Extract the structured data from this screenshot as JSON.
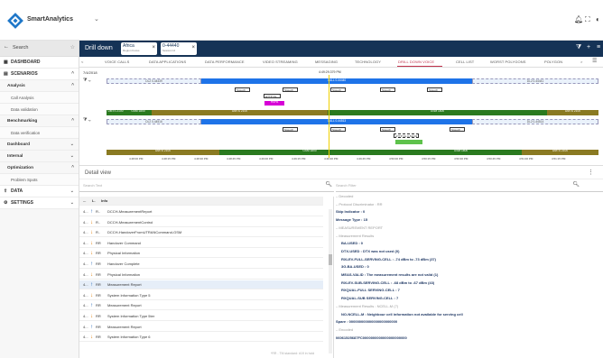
{
  "app": {
    "brand": "SmartAnalytics"
  },
  "sidebar": {
    "search_label": "Search",
    "items": [
      {
        "label": "DASHBOARD",
        "kind": "section"
      },
      {
        "label": "SCENARIOS",
        "kind": "section"
      },
      {
        "label": "Analysis",
        "kind": "sub"
      },
      {
        "label": "Call Analysis",
        "kind": "leaf"
      },
      {
        "label": "Data validation",
        "kind": "leaf"
      },
      {
        "label": "Benchmarking",
        "kind": "sub"
      },
      {
        "label": "Data verification",
        "kind": "leaf"
      },
      {
        "label": "Dashboard",
        "kind": "sub"
      },
      {
        "label": "Internal",
        "kind": "sub"
      },
      {
        "label": "Optimization",
        "kind": "sub"
      },
      {
        "label": "Problem Spots",
        "kind": "leaf"
      },
      {
        "label": "DATA",
        "kind": "section"
      },
      {
        "label": "SETTINGS",
        "kind": "section"
      }
    ]
  },
  "header": {
    "title": "Drill down",
    "chip1": {
      "main": "Africa",
      "sub": "Region Focus"
    },
    "chip2": {
      "main": "0-44440",
      "sub": "Session Id"
    }
  },
  "tabs": [
    "VOICE CALLS",
    "DATA APPLICATIONS",
    "DATA PERFORMANCE",
    "VIDEO STREAMING",
    "MESSAGING",
    "TECHNOLOGY",
    "DRILL DOWN VOICE",
    "CELL LIST",
    "WORST POLYGONS",
    "POLYGON"
  ],
  "timeline": {
    "date": "7/4/2018",
    "cursor_time": "4:49:29.379 PM",
    "track1": {
      "label": "DL2 0-44439",
      "mid": "CALL 0-44440",
      "right": "DL2 0-44441"
    },
    "track2": {
      "label": "DL2 0-44516",
      "mid": "CALL 0-44513",
      "right": "DL2 0-44514"
    },
    "msgs": [
      "Speech...",
      "Speech...",
      "Speech...",
      "Speech...",
      "Speech...",
      "HTTP DL...",
      "HSPA"
    ],
    "umts": [
      "UMTS 2100",
      "GSM 1800",
      "UMTS 2100",
      "GSM 1800",
      "UMTS 2100"
    ],
    "umts2": [
      "UMTS 2100",
      "GSM 1800",
      "GSM 1800",
      "UMTS 2100"
    ],
    "sub_msgs": [
      "Speech...",
      "Speech...",
      "Speech...",
      "HTTP DL 0-54234",
      "Speech..."
    ],
    "ticks": [
      "4:48:00 PM",
      "4:48:15 PM",
      "4:48:30 PM",
      "4:48:45 PM",
      "4:49:00 PM",
      "4:49:15 PM",
      "4:49:30 PM",
      "4:49:45 PM",
      "4:50:00 PM",
      "4:50:15 PM",
      "4:50:30 PM",
      "4:50:45 PM",
      "4:51:00 PM",
      "4:51:15 PM"
    ]
  },
  "detail": {
    "title": "Detail view",
    "search_placeholder": "Search Text",
    "filter_placeholder": "Search Filter",
    "columns": [
      "...",
      "L.",
      "Info"
    ],
    "rows": [
      {
        "n": "4...",
        "dir": "up",
        "l": "R..",
        "info": "DCCH-MeasurementReport"
      },
      {
        "n": "4...",
        "dir": "down",
        "l": "R..",
        "info": "DCCH-MeasurementControl"
      },
      {
        "n": "4...",
        "dir": "down",
        "l": "R..",
        "info": "DCCH-HandoverFromUTRANCommand-GSM"
      },
      {
        "n": "4...",
        "dir": "down",
        "l": "RR",
        "info": "Handover Command"
      },
      {
        "n": "4...",
        "dir": "down",
        "l": "RR",
        "info": "Physical Information"
      },
      {
        "n": "4...",
        "dir": "up",
        "l": "RR",
        "info": "Handover Complete"
      },
      {
        "n": "4...",
        "dir": "down",
        "l": "RR",
        "info": "Physical Information"
      },
      {
        "n": "4...",
        "dir": "up",
        "l": "RR",
        "info": "Measurement Report"
      },
      {
        "n": "4...",
        "dir": "down",
        "l": "RR",
        "info": "System Information Type 5"
      },
      {
        "n": "4...",
        "dir": "up",
        "l": "RR",
        "info": "Measurement Report"
      },
      {
        "n": "4...",
        "dir": "down",
        "l": "RR",
        "info": "System Information Type 5ter"
      },
      {
        "n": "4...",
        "dir": "up",
        "l": "RR",
        "info": "Measurement Report"
      },
      {
        "n": "4...",
        "dir": "down",
        "l": "RR",
        "info": "System Information Type 6"
      }
    ],
    "decoded": [
      {
        "t": "– Decoded",
        "s": "g"
      },
      {
        "t": "– Protocol Discriminator : RR",
        "s": "g"
      },
      {
        "t": "Skip Indicator : 0",
        "s": "b"
      },
      {
        "t": "Message Type : 15",
        "s": "b"
      },
      {
        "t": "– MEASUREMENT REPORT",
        "s": "g"
      },
      {
        "t": "– Measurement Results",
        "s": "g"
      },
      {
        "t": "BA-USED : 0",
        "s": "b"
      },
      {
        "t": "DTX-USED : DTX was not used (0)",
        "s": "b"
      },
      {
        "t": "RXLEV-FULL-SERVING-CELL : -74 dBm to -73 dBm (37)",
        "s": "b"
      },
      {
        "t": "3G-BA-USED : 0",
        "s": "b"
      },
      {
        "t": "MEAS-VALID : The measurement results are not valid (1)",
        "s": "b"
      },
      {
        "t": "RXLEV-SUB-SERVING-CELL : -68 dBm to -67 dBm (43)",
        "s": "b"
      },
      {
        "t": "RXQUAL-FULL SERVING-CELL : 7",
        "s": "b"
      },
      {
        "t": "RXQUAL-SUB SERVING-CELL : 7",
        "s": "b"
      },
      {
        "t": "– Measurement Results : NCELL-M (7)",
        "s": "g"
      },
      {
        "t": "NO-NCELL-M : Neighbour cell information not available for serving cell",
        "s": "b"
      },
      {
        "t": "Spare : 000000000000000000000000",
        "s": "b"
      },
      {
        "t": "– Encoded",
        "s": "g"
      },
      {
        "t": "06061525687FC0000000000000000000000",
        "s": "b"
      }
    ],
    "footer": "*RR - TM standard: #19 in hold"
  }
}
